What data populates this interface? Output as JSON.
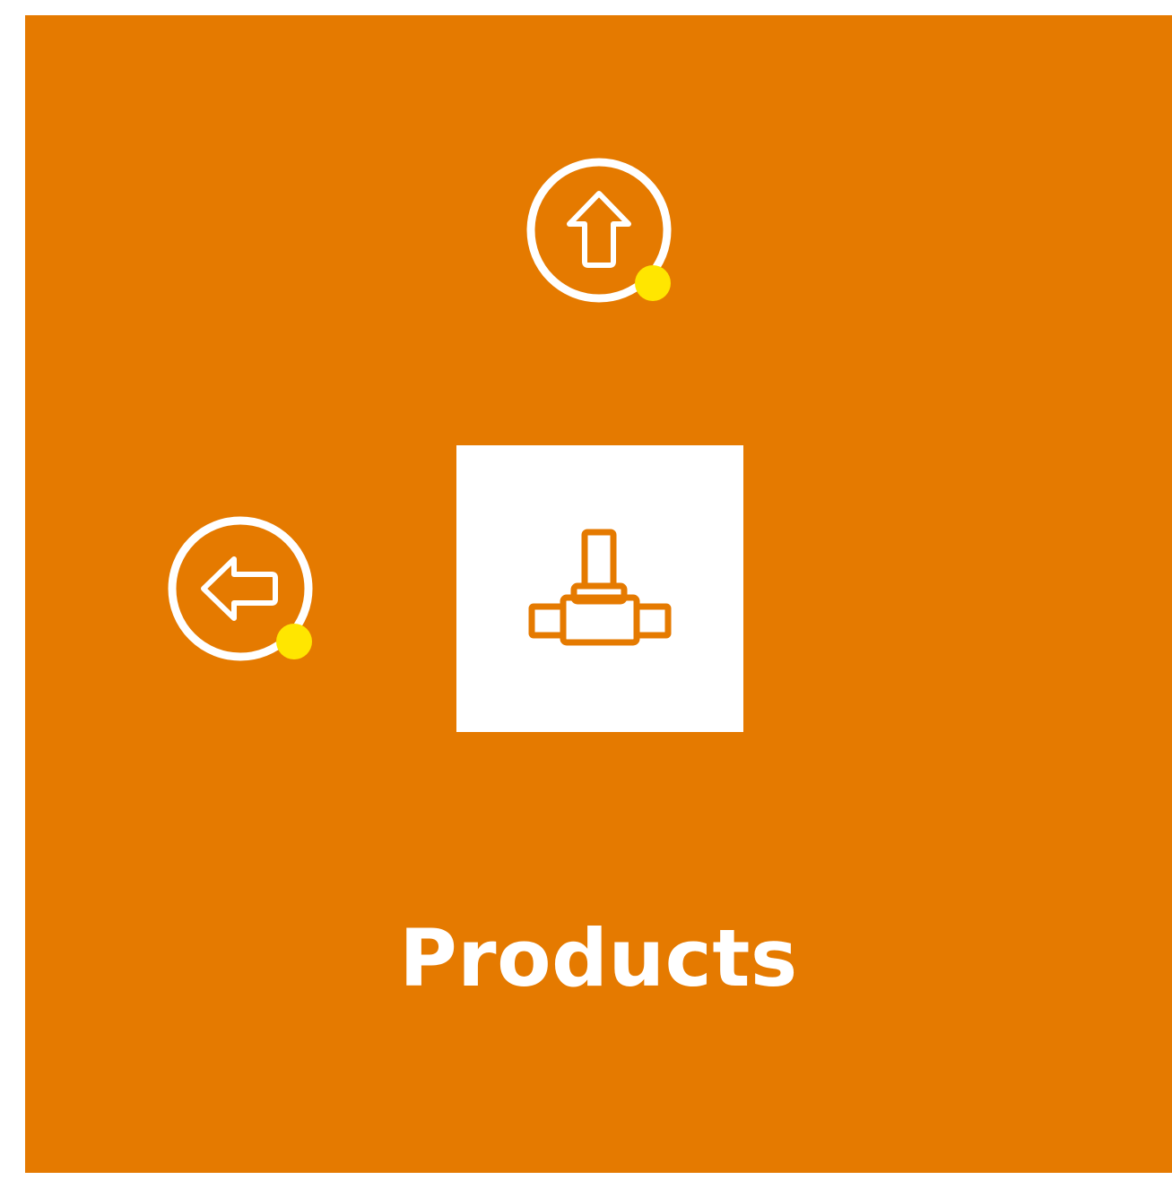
{
  "tile": {
    "background_color": "#E57A00",
    "title": "Products"
  },
  "nav": {
    "up_icon": "arrow-up-icon",
    "left_icon": "arrow-left-icon",
    "indicator_color": "#FFE600"
  },
  "center_icon": "pipe-tee-fitting-icon"
}
